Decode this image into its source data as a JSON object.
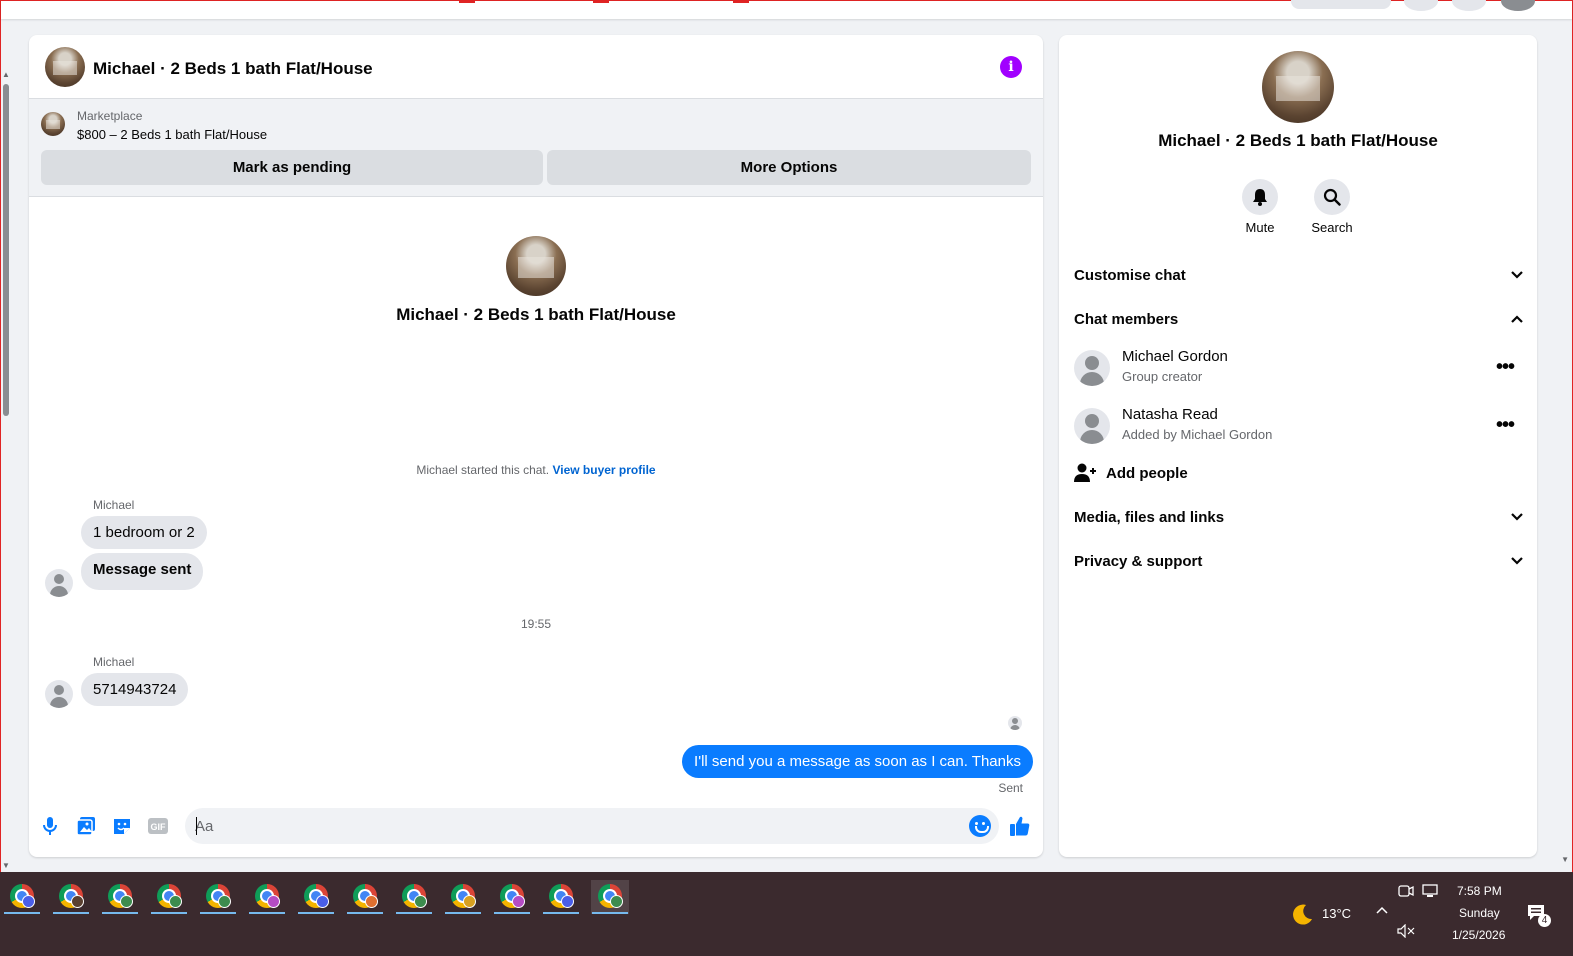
{
  "chat": {
    "header_title": "Michael · 2 Beds 1 bath Flat/House",
    "marketplace_label": "Marketplace",
    "listing": "$800 – 2 Beds 1 bath Flat/House",
    "mark_pending": "Mark as pending",
    "more_options": "More Options",
    "intro_title": "Michael · 2 Beds 1 bath Flat/House",
    "started_text": "Michael started this chat.",
    "view_buyer_profile": "View buyer profile",
    "messages": [
      {
        "sender": "Michael",
        "text": "1 bedroom or 2"
      },
      {
        "text": "Message sent"
      },
      {
        "sender": "Michael",
        "text": "5714943724"
      },
      {
        "text": "I'll send you a message as soon as I can. Thanks"
      }
    ],
    "timestamp": "19:55",
    "sent_label": "Sent",
    "composer_placeholder": "Aa"
  },
  "info_panel": {
    "title": "Michael · 2 Beds 1 bath Flat/House",
    "mute": "Mute",
    "search": "Search",
    "customise_chat": "Customise chat",
    "chat_members": "Chat members",
    "members": [
      {
        "name": "Michael Gordon",
        "role": "Group creator"
      },
      {
        "name": "Natasha Read",
        "role": "Added by Michael Gordon"
      }
    ],
    "add_people": "Add people",
    "media_files_links": "Media, files and links",
    "privacy_support": "Privacy & support"
  },
  "taskbar": {
    "weather": "13°C",
    "time": "7:58 PM",
    "day": "Sunday",
    "date": "1/25/2026",
    "notification_count": "4",
    "badge_colors": [
      "#4a5ee8",
      "#5a4030",
      "#3d8c4e",
      "#3d8c4e",
      "#3d8c4e",
      "#b54cc4",
      "#4a5ee8",
      "#e07030",
      "#3d8c4e",
      "#d8a020",
      "#b54cc4",
      "#4a5ee8",
      "#3d8c4e"
    ]
  },
  "colors": {
    "accent": "#0a7cff",
    "info": "#a100ff",
    "link": "#0064d1"
  }
}
